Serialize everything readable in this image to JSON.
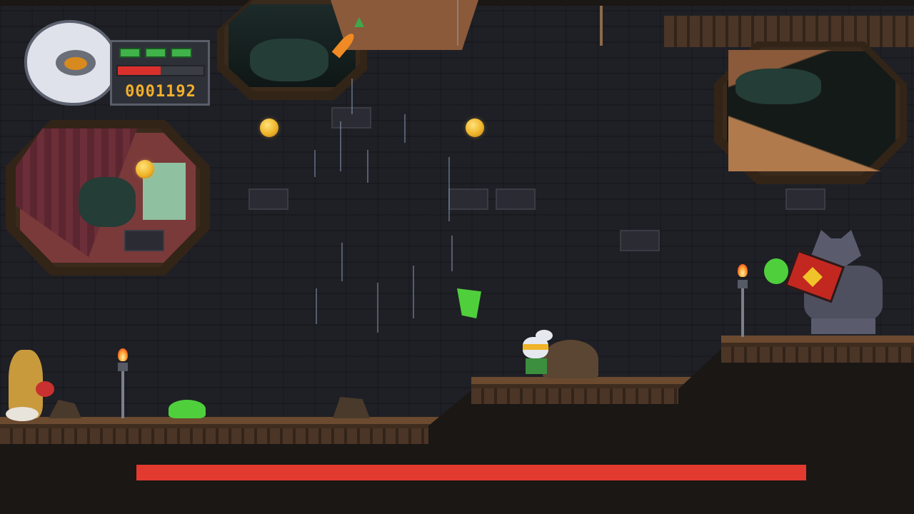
{
  "hud": {
    "score": "0001192",
    "health_segments": [
      true,
      true,
      true
    ],
    "energy_fraction": 0.5,
    "portrait_icon": "rabbit-pilot-icon",
    "colors": {
      "health": "#40b34a",
      "energy": "#d9302c",
      "score": "#f3b02a"
    }
  },
  "boss": {
    "health_fraction": 1.0,
    "color": "#e23a2f"
  },
  "entities": {
    "player": "rabbit-hero",
    "boss": "robot-wolf-boss",
    "enemy": "yellow-frog-boxer",
    "pickups": [
      "carrot",
      "coin",
      "coin",
      "coin"
    ],
    "projectiles": [
      "green-slime-shot",
      "green-slime-splat"
    ]
  }
}
